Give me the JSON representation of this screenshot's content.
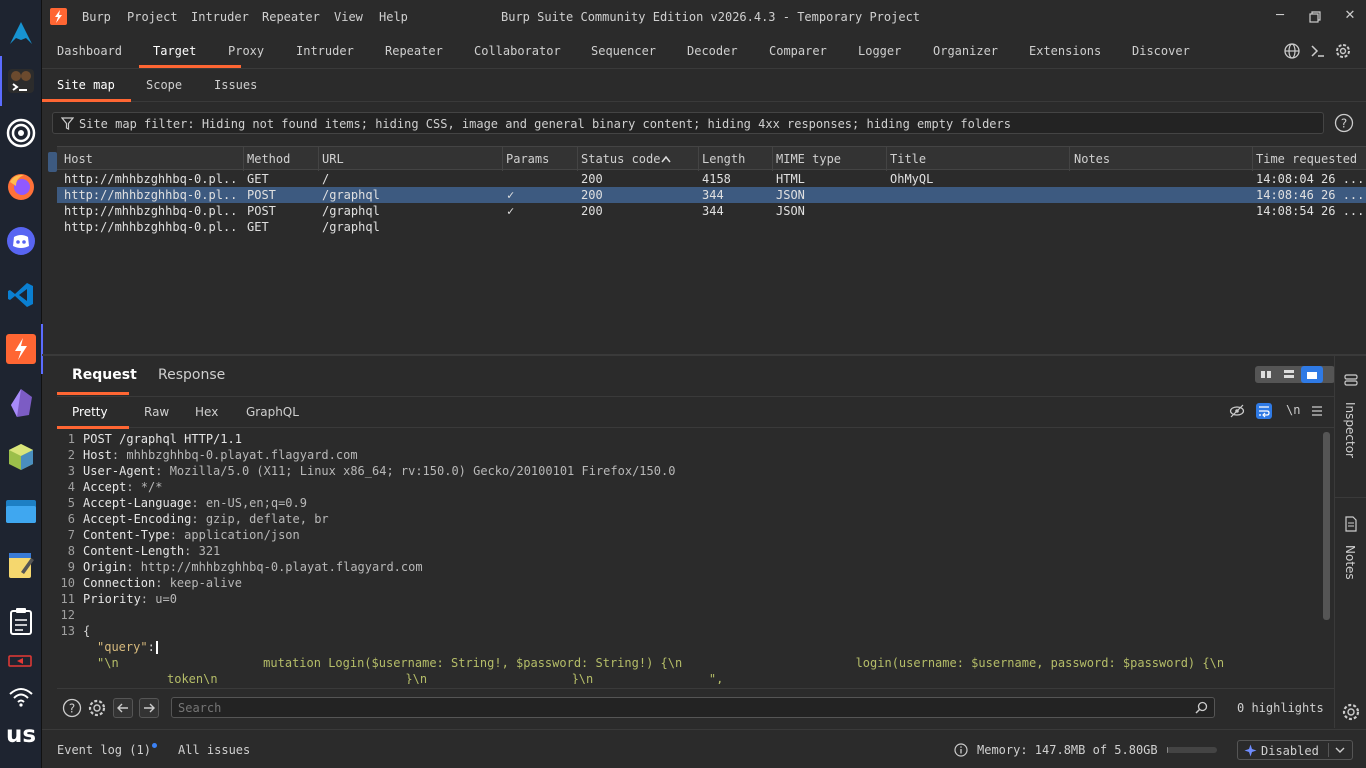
{
  "app": {
    "title": "Burp Suite Community Edition v2026.4.3 - Temporary Project",
    "menu": [
      "Burp",
      "Project",
      "Intruder",
      "Repeater",
      "View",
      "Help"
    ],
    "accent_color": "#ff6633"
  },
  "dock": {
    "items": [
      "arch-logo-icon",
      "terminal-icon",
      "target-icon",
      "firefox-icon",
      "discord-icon",
      "vscode-icon",
      "burp-icon",
      "obsidian-icon",
      "package-icon",
      "files-icon",
      "notepad-icon",
      "clipboard-icon",
      "battery-icon",
      "wifi-icon"
    ],
    "keyboard_layout": "us"
  },
  "main_tabs": [
    "Dashboard",
    "Target",
    "Proxy",
    "Intruder",
    "Repeater",
    "Collaborator",
    "Sequencer",
    "Decoder",
    "Comparer",
    "Logger",
    "Organizer",
    "Extensions",
    "Discover"
  ],
  "main_tabs_active": "Target",
  "sub_tabs": [
    "Site map",
    "Scope",
    "Issues"
  ],
  "sub_tabs_active": "Site map",
  "filter": {
    "text": "Site map filter: Hiding not found items; hiding CSS, image and general binary content; hiding 4xx responses; hiding empty folders"
  },
  "table": {
    "columns": [
      "Host",
      "Method",
      "URL",
      "Params",
      "Status code",
      "Length",
      "MIME type",
      "Title",
      "Notes",
      "Time requested"
    ],
    "sorted_column": "Status code",
    "rows": [
      {
        "host": "http://mhhbzghhbq-0.pl...",
        "method": "GET",
        "url": "/",
        "params": "",
        "status": "200",
        "length": "4158",
        "mime": "HTML",
        "title": "OhMyQL",
        "notes": "",
        "time": "14:08:04 26 ...",
        "selected": false
      },
      {
        "host": "http://mhhbzghhbq-0.pl...",
        "method": "POST",
        "url": "/graphql",
        "params": "✓",
        "status": "200",
        "length": "344",
        "mime": "JSON",
        "title": "",
        "notes": "",
        "time": "14:08:46 26 ...",
        "selected": true
      },
      {
        "host": "http://mhhbzghhbq-0.pl...",
        "method": "POST",
        "url": "/graphql",
        "params": "✓",
        "status": "200",
        "length": "344",
        "mime": "JSON",
        "title": "",
        "notes": "",
        "time": "14:08:54 26 ...",
        "selected": false
      },
      {
        "host": "http://mhhbzghhbq-0.pl...",
        "method": "GET",
        "url": "/graphql",
        "params": "",
        "status": "",
        "length": "",
        "mime": "",
        "title": "",
        "notes": "",
        "time": "",
        "selected": false
      }
    ]
  },
  "request_panel": {
    "tabs": [
      "Request",
      "Response"
    ],
    "active_tab": "Request",
    "view_tabs": [
      "Pretty",
      "Raw",
      "Hex",
      "GraphQL"
    ],
    "active_view": "Pretty",
    "newline_toggle": "\\n",
    "lines": [
      {
        "n": "1",
        "name": "POST /graphql HTTP/1.1",
        "value": ""
      },
      {
        "n": "2",
        "name": "Host",
        "value": ": mhhbzghhbq-0.playat.flagyard.com"
      },
      {
        "n": "3",
        "name": "User-Agent",
        "value": ": Mozilla/5.0 (X11; Linux x86_64; rv:150.0) Gecko/20100101 Firefox/150.0"
      },
      {
        "n": "4",
        "name": "Accept",
        "value": ": */*"
      },
      {
        "n": "5",
        "name": "Accept-Language",
        "value": ": en-US,en;q=0.9"
      },
      {
        "n": "6",
        "name": "Accept-Encoding",
        "value": ": gzip, deflate, br"
      },
      {
        "n": "7",
        "name": "Content-Type",
        "value": ": application/json"
      },
      {
        "n": "8",
        "name": "Content-Length",
        "value": ": 321"
      },
      {
        "n": "9",
        "name": "Origin",
        "value": ": http://mhhbzghhbq-0.playat.flagyard.com"
      },
      {
        "n": "10",
        "name": "Connection",
        "value": ": keep-alive"
      },
      {
        "n": "11",
        "name": "Priority",
        "value": ": u=0"
      },
      {
        "n": "12",
        "name": "",
        "value": ""
      },
      {
        "n": "13",
        "name": "{",
        "value": ""
      }
    ],
    "json_key": "\"query\"",
    "json_colon": ":",
    "json_value_line1": "\"\\n                    mutation Login($username: String!, $password: String!) {\\n                        login(username: $username, password: $password) {\\n",
    "json_value_line2": "token\\n                          }\\n                    }\\n                \","
  },
  "search": {
    "placeholder": "Search",
    "highlights": "0 highlights"
  },
  "side_panel": {
    "inspector": "Inspector",
    "notes": "Notes"
  },
  "status_bar": {
    "event_log": "Event log (1)",
    "all_issues": "All issues",
    "memory": "Memory: 147.8MB of 5.80GB",
    "memory_fraction": 0.025,
    "ai_state": "Disabled"
  }
}
